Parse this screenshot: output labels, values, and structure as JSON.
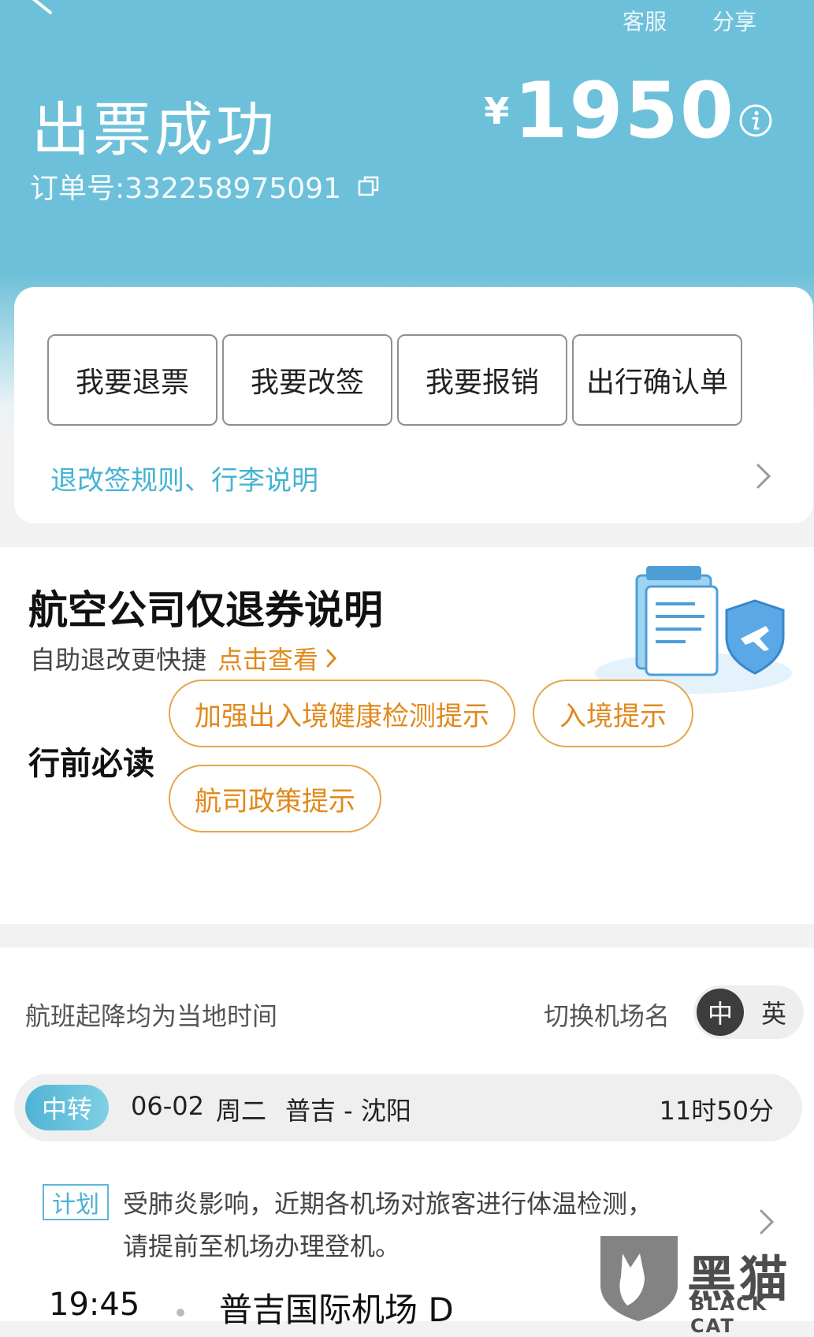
{
  "header": {
    "customer_service": "客服",
    "share": "分享",
    "status_title": "出票成功",
    "order_label": "订单号:332258975091",
    "currency": "¥",
    "price": "1950"
  },
  "actions": {
    "refund": "我要退票",
    "change": "我要改签",
    "reimburse": "我要报销",
    "confirmation": "出行确认单",
    "rules_link": "退改签规则、行李说明"
  },
  "refund_notice": {
    "title": "航空公司仅退券说明",
    "subtitle": "自助退改更快捷",
    "link": "点击查看"
  },
  "must_read": {
    "label": "行前必读",
    "tips": [
      "加强出入境健康检测提示",
      "入境提示",
      "航司政策提示"
    ]
  },
  "flight": {
    "local_time_note": "航班起降均为当地时间",
    "switch_airport_label": "切换机场名",
    "lang_zh": "中",
    "lang_en": "英",
    "leg": {
      "badge": "中转",
      "date": "06-02",
      "weekday": "周二",
      "route": "普吉 - 沈阳",
      "duration": "11时50分"
    },
    "plan_badge": "计划",
    "notice_line1": "受肺炎影响，近期各机场对旅客进行体温检测，",
    "notice_line2": "请提前至机场办理登机。",
    "dep_time": "19:45",
    "dep_airport": "普吉国际机场 D"
  },
  "watermark": {
    "text": "黑猫",
    "sub": "BLACK CAT"
  },
  "colors": {
    "header_bg": "#6dc0d9",
    "accent_blue": "#45b3d3",
    "accent_orange": "#e0891c"
  }
}
